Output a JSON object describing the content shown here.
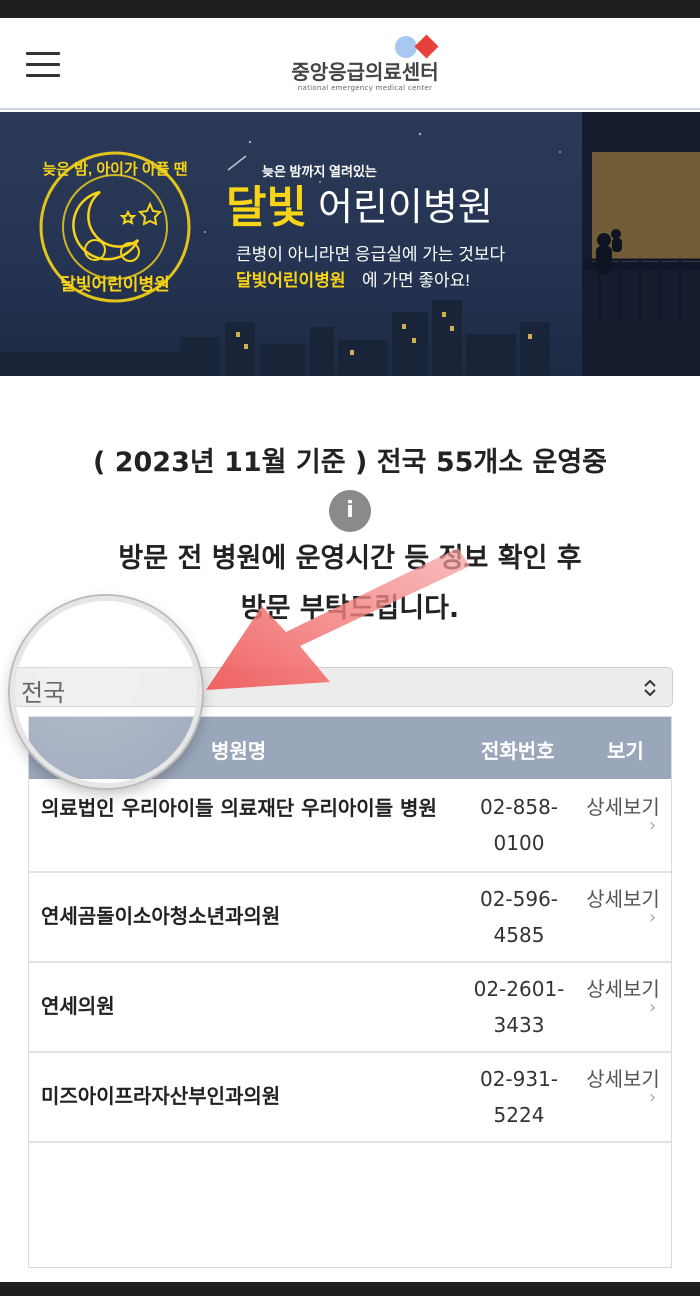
{
  "header": {
    "logo_title": "중앙응급의료센터",
    "logo_subtitle": "national emergency medical center"
  },
  "banner": {
    "badge_text_top": "늦은 밤, 아이가 아플 땐",
    "badge_text_bottom": "달빛어린이병원",
    "tagline_small": "늦은 밤까지 열려있는",
    "title_highlight": "달빛",
    "title_rest": "어린이병원",
    "desc_line1": "큰병이 아니라면 응급실에 가는 것보다",
    "desc_line2_highlight": "달빛어린이병원",
    "desc_line2_rest": "에 가면 좋아요!",
    "colors": {
      "yellow": "#f7d417",
      "night": "#253452"
    }
  },
  "notice": {
    "line1": "( 2023년 11월 기준 ) 전국 55개소 운영중",
    "info_glyph": "i",
    "line2": "방문 전 병원에 운영시간 등 정보 확인 후",
    "line3": "방문 부탁드립니다."
  },
  "region_select": {
    "selected": "전국"
  },
  "table": {
    "headers": {
      "name": "병원명",
      "phone": "전화번호",
      "view": "보기"
    },
    "rows": [
      {
        "name": "의료법인 우리아이들 의료재단 우리아이들 병원",
        "phone": "02-858-0100",
        "view": "상세보기"
      },
      {
        "name": "연세곰돌이소아청소년과의원",
        "phone": "02-596-4585",
        "view": "상세보기"
      },
      {
        "name": "연세의원",
        "phone": "02-2601-3433",
        "view": "상세보기"
      },
      {
        "name": "미즈아이프라자산부인과의원",
        "phone": "02-931-5224",
        "view": "상세보기"
      }
    ]
  },
  "colors": {
    "accent_red": "#f26b6b",
    "table_header": "#9aa6ba"
  }
}
